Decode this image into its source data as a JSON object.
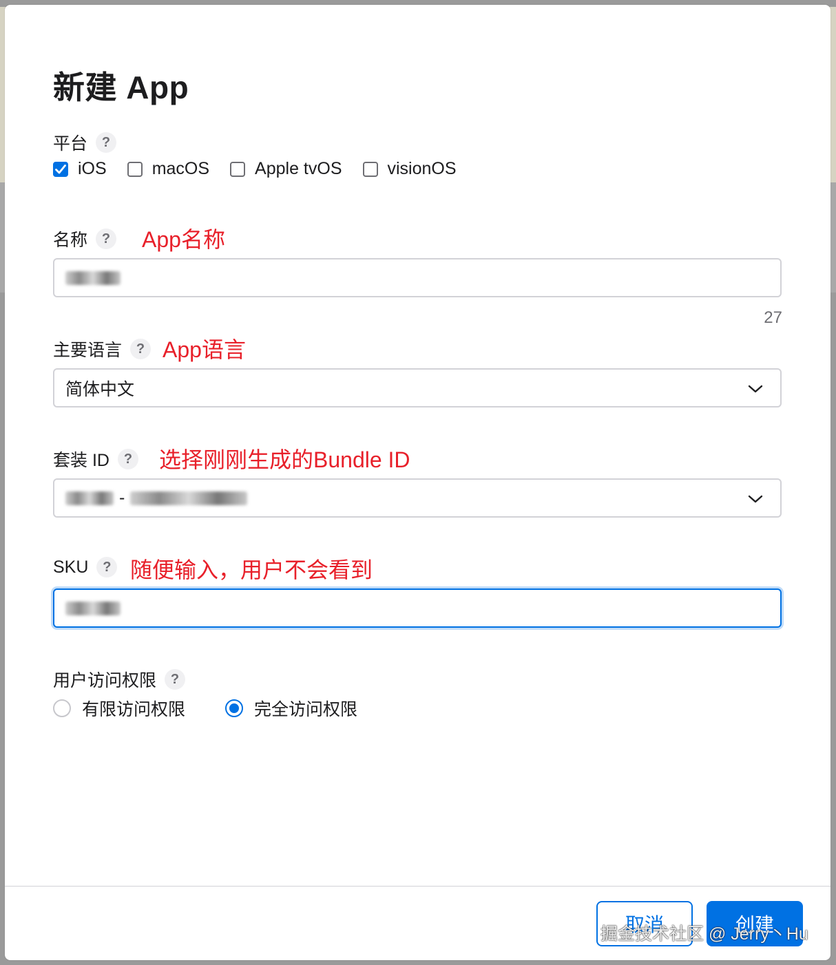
{
  "dialog": {
    "title": "新建 App"
  },
  "platform": {
    "label": "平台",
    "help": "?",
    "options": [
      {
        "label": "iOS",
        "checked": true
      },
      {
        "label": "macOS",
        "checked": false
      },
      {
        "label": "Apple tvOS",
        "checked": false
      },
      {
        "label": "visionOS",
        "checked": false
      }
    ]
  },
  "name": {
    "label": "名称",
    "help": "?",
    "annotation": "App名称",
    "counter": "27"
  },
  "language": {
    "label": "主要语言",
    "help": "?",
    "annotation": "App语言",
    "selected": "简体中文"
  },
  "bundle": {
    "label": "套装 ID",
    "help": "?",
    "annotation": "选择刚刚生成的Bundle ID"
  },
  "sku": {
    "label": "SKU",
    "help": "?",
    "annotation": "随便输入，用户不会看到"
  },
  "access": {
    "label": "用户访问权限",
    "help": "?",
    "options": [
      {
        "label": "有限访问权限",
        "selected": false
      },
      {
        "label": "完全访问权限",
        "selected": true
      }
    ]
  },
  "footer": {
    "cancel_label": "取消",
    "create_label": "创建"
  },
  "watermark": "掘金技术社区 @ Jerry丶Hu",
  "colors": {
    "accent": "#0071e3",
    "annotation": "#e8202a"
  }
}
